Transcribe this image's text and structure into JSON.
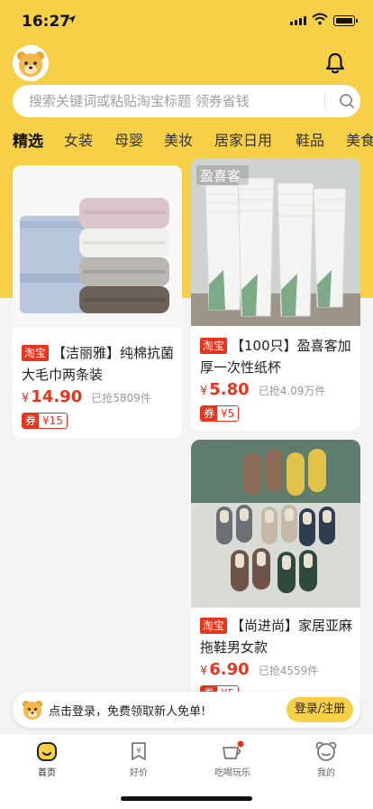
{
  "status": {
    "time": "16:27"
  },
  "search": {
    "placeholder": "搜索关键词或粘贴淘宝标题 领券省钱"
  },
  "tabs": [
    "精选",
    "女装",
    "母婴",
    "美妆",
    "居家日用",
    "鞋品",
    "美食"
  ],
  "products": [
    {
      "tag": "淘宝",
      "title": "【洁丽雅】纯棉抗菌大毛巾两条装",
      "currency": "¥",
      "price": "14.90",
      "sold": "已抢5809件",
      "coupon_label": "券",
      "coupon_value": "¥15"
    },
    {
      "tag": "淘宝",
      "title": "【100只】盈喜客加厚一次性纸杯",
      "currency": "¥",
      "price": "5.80",
      "sold": "已抢4.09万件",
      "coupon_label": "券",
      "coupon_value": "¥5",
      "image_brand": "盈喜客"
    },
    {
      "tag": "淘宝",
      "title": "【尚进尚】家居亚麻拖鞋男女款",
      "currency": "¥",
      "price": "6.90",
      "sold": "已抢4559件",
      "coupon_label": "券",
      "coupon_value": "¥5"
    }
  ],
  "login_banner": {
    "text": "点击登录，免费领取新人免单!",
    "button": "登录/注册"
  },
  "tabbar": [
    {
      "label": "首页",
      "icon": "home-icon"
    },
    {
      "label": "好价",
      "icon": "price-tag-icon"
    },
    {
      "label": "吃喝玩乐",
      "icon": "cup-icon"
    },
    {
      "label": "我的",
      "icon": "bear-profile-icon"
    }
  ],
  "colors": {
    "brand_yellow": "#f7d048",
    "price_red": "#e8341c",
    "notification_dot": "#e8341c"
  }
}
